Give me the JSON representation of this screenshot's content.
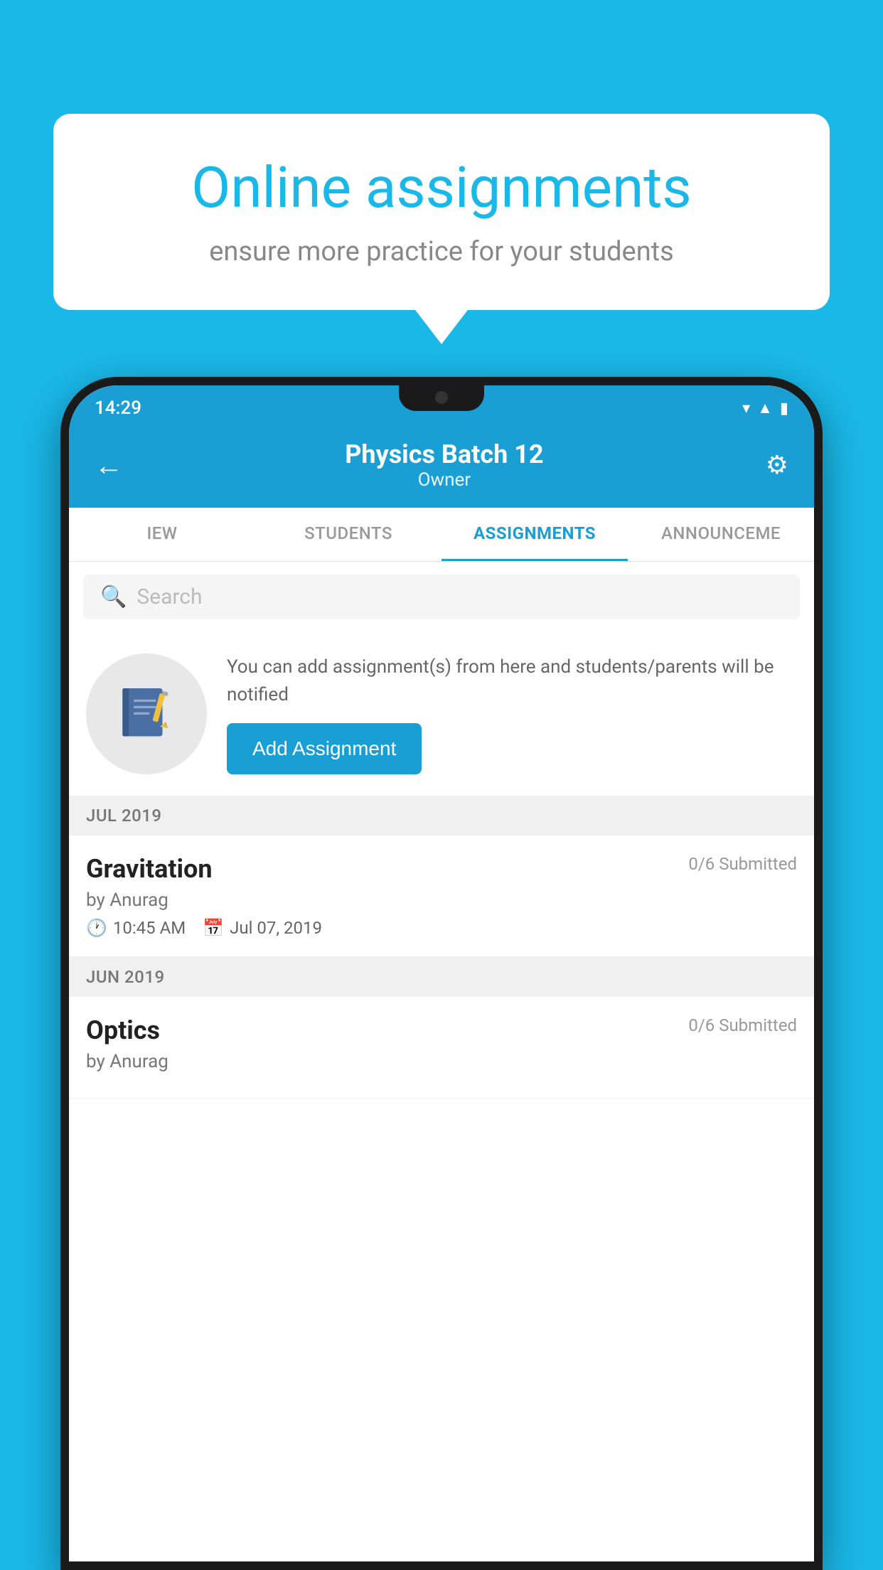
{
  "background_color": "#1ab8e8",
  "speech_bubble": {
    "headline": "Online assignments",
    "subtext": "ensure more practice for your students"
  },
  "status_bar": {
    "time": "14:29",
    "icons": [
      "wifi",
      "signal",
      "battery"
    ]
  },
  "header": {
    "title": "Physics Batch 12",
    "subtitle": "Owner",
    "back_label": "←",
    "settings_label": "⚙"
  },
  "tabs": [
    {
      "label": "IEW",
      "active": false
    },
    {
      "label": "STUDENTS",
      "active": false
    },
    {
      "label": "ASSIGNMENTS",
      "active": true
    },
    {
      "label": "ANNOUNCEME",
      "active": false
    }
  ],
  "search": {
    "placeholder": "Search"
  },
  "empty_state": {
    "description": "You can add assignment(s) from here and students/parents will be notified",
    "add_button_label": "Add Assignment"
  },
  "sections": [
    {
      "month_label": "JUL 2019",
      "assignments": [
        {
          "title": "Gravitation",
          "submitted": "0/6 Submitted",
          "by": "by Anurag",
          "time": "10:45 AM",
          "date": "Jul 07, 2019"
        }
      ]
    },
    {
      "month_label": "JUN 2019",
      "assignments": [
        {
          "title": "Optics",
          "submitted": "0/6 Submitted",
          "by": "by Anurag",
          "time": "",
          "date": ""
        }
      ]
    }
  ]
}
